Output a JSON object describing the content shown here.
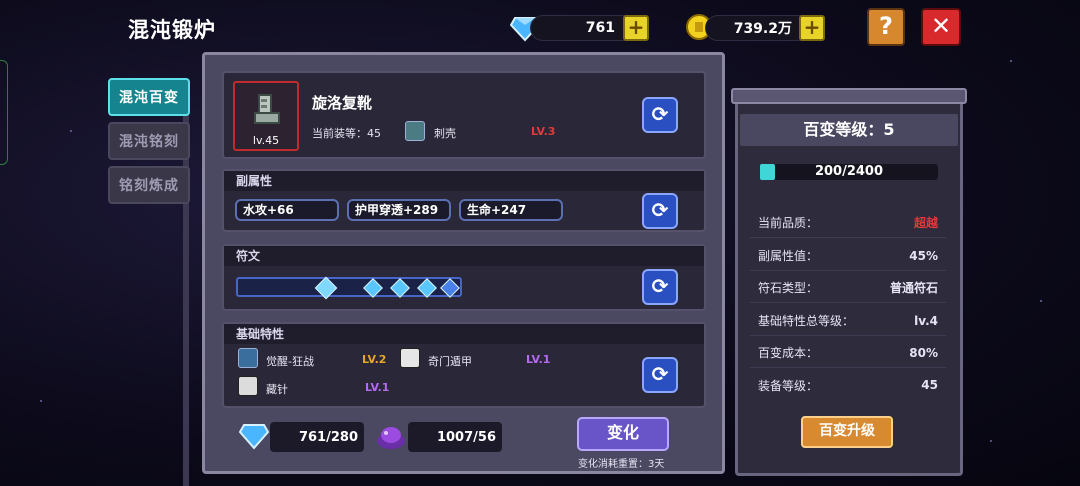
{
  "header": {
    "title": "混沌锻炉",
    "gems": "761",
    "gold": "739.2万",
    "plus_label": "+",
    "help_label": "?",
    "close_label": "✕"
  },
  "tabs": [
    {
      "label": "混沌百变",
      "active": true
    },
    {
      "label": "混沌铭刻",
      "active": false
    },
    {
      "label": "铭刻炼成",
      "active": false
    }
  ],
  "item": {
    "name": "旋洛复靴",
    "level": "lv.45",
    "equip_text": "当前装等：45",
    "gem_name": "刺壳",
    "gem_level": "LV.3"
  },
  "sub_attr": {
    "header": "副属性",
    "values": [
      "水攻+66",
      "护甲穿透+289",
      "生命+247"
    ]
  },
  "runes": {
    "header": "符文"
  },
  "base_traits": {
    "header": "基础特性",
    "items": [
      {
        "name": "觉醒-狂战",
        "level": "LV.2"
      },
      {
        "name": "奇门遁甲",
        "level": "LV.1"
      },
      {
        "name": "藏针",
        "level": "LV.1"
      }
    ]
  },
  "costs": {
    "gem_cost": "761/280",
    "material_cost": "1007/56"
  },
  "change": {
    "label": "变化",
    "note": "变化消耗重置：3天"
  },
  "right": {
    "header": "百变等级：5",
    "progress_text": "200/2400",
    "progress_fraction": 0.0833,
    "stats": [
      {
        "label": "当前品质：",
        "value": "超越",
        "color": "#e0393b"
      },
      {
        "label": "副属性值：",
        "value": "45%"
      },
      {
        "label": "符石类型：",
        "value": "普通符石"
      },
      {
        "label": "基础特性总等级：",
        "value": "lv.4"
      },
      {
        "label": "百变成本：",
        "value": "80%"
      },
      {
        "label": "装备等级：",
        "value": "45"
      }
    ],
    "upgrade_label": "百变升级"
  },
  "colors": {
    "active_tab": "#16848f",
    "accent_gold": "#e8d428",
    "quality_red": "#e0393b"
  }
}
